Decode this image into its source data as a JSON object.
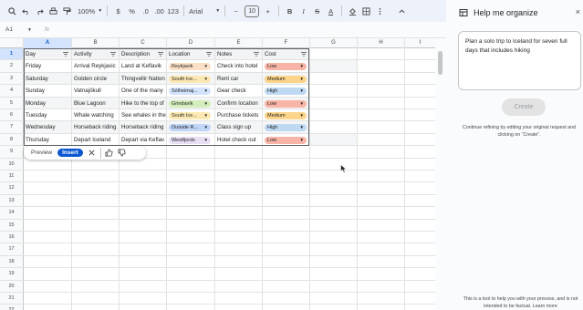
{
  "toolbar": {
    "zoom": "100%",
    "currency": "$",
    "percent": "%",
    "dec_decrease": ".0",
    "dec_increase": ".00",
    "number_format": "123",
    "font": "Arial",
    "minus": "−",
    "font_size": "10",
    "plus": "+",
    "bold": "B",
    "italic": "I",
    "strike": "S",
    "text_color": "A"
  },
  "formula_bar": {
    "cell_ref": "A1",
    "fx": "fx"
  },
  "columns": [
    "A",
    "B",
    "C",
    "D",
    "E",
    "F",
    "G",
    "H",
    "I"
  ],
  "rows": [
    "1",
    "2",
    "3",
    "4",
    "5",
    "6",
    "7",
    "8",
    "9",
    "10",
    "11",
    "12",
    "13",
    "14",
    "15",
    "16",
    "17",
    "18",
    "19",
    "20",
    "21",
    "22"
  ],
  "table": {
    "headers": [
      "Day",
      "Activity",
      "Description",
      "Location",
      "Notes",
      "Cost"
    ],
    "data": [
      {
        "day": "Friday",
        "activity": "Arrival Reykjavic",
        "description": "Land at Keflavik",
        "location": "Reykjavik",
        "notes": "Check into hotel",
        "cost": "Low"
      },
      {
        "day": "Saturday",
        "activity": "Golden circle",
        "description": "Thingvellir Nation",
        "location": "South Ice...",
        "notes": "Rent car",
        "cost": "Medium"
      },
      {
        "day": "Sunday",
        "activity": "Vatnajökull",
        "description": "One of the many",
        "location": "Sólheimaj...",
        "notes": "Gear check",
        "cost": "High"
      },
      {
        "day": "Monday",
        "activity": "Blue Lagoon",
        "description": "Hike to the top of",
        "location": "Grindavík",
        "notes": "Confirm location",
        "cost": "Low"
      },
      {
        "day": "Tuesday",
        "activity": "Whale watching",
        "description": "See whales in the",
        "location": "South Ice...",
        "notes": "Purchase tickets",
        "cost": "Medium"
      },
      {
        "day": "Wednesday",
        "activity": "Horseback riding",
        "description": "Horseback riding",
        "location": "Outside R...",
        "notes": "Class sign up",
        "cost": "High"
      },
      {
        "day": "Thursday",
        "activity": "Depart Iceland",
        "description": "Depart via Keflav",
        "location": "Westfjords",
        "notes": "Hotel check out",
        "cost": "Low"
      }
    ]
  },
  "location_colors": {
    "Reykjavik": "#fbe0c6",
    "South Ice...": "#fce8b2",
    "Sólheimaj...": "#d3e3fd",
    "Grindavík": "#d4edbc",
    "Outside R...": "#c2d7f8",
    "Westfjords": "#e8dff5"
  },
  "cost_colors": {
    "Low": "#f8b4a6",
    "Medium": "#fcd58a",
    "High": "#bfd9f2"
  },
  "preview_bar": {
    "preview": "Preview",
    "insert": "Insert"
  },
  "panel": {
    "title": "Help me organize",
    "close": "×",
    "prompt": "Plan a solo trip to Iceland for seven full days that includes hiking",
    "create": "Create",
    "hint": "Continue refining by editing your original request and clicking on “Create”.",
    "footer": "This is a tool to help you with your process, and is not intended to be factual. Learn more"
  },
  "colors": {
    "accent": "#0b57d0",
    "selection": "#d3e3fd"
  }
}
